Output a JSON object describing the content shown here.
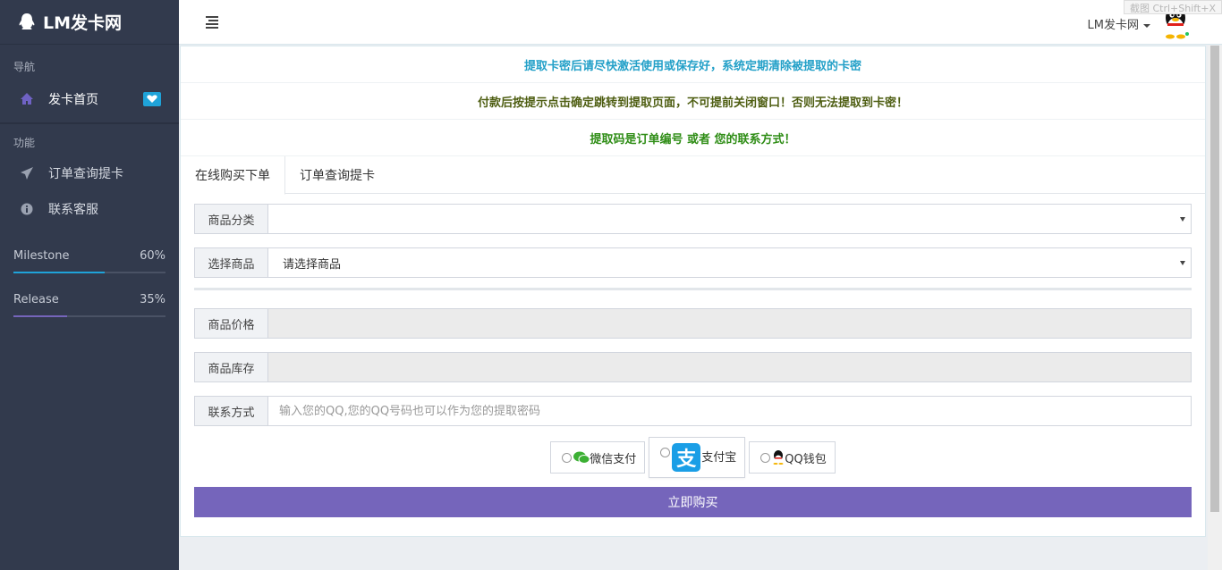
{
  "sidebar": {
    "brand": "LM发卡网",
    "sections": [
      {
        "title": "导航",
        "items": [
          {
            "label": "发卡首页",
            "icon": "home-icon",
            "active": true,
            "badge": "heart-icon"
          }
        ]
      },
      {
        "title": "功能",
        "items": [
          {
            "label": "订单查询提卡",
            "icon": "send-icon"
          },
          {
            "label": "联系客服",
            "icon": "info-icon"
          }
        ]
      }
    ],
    "progress": [
      {
        "label": "Milestone",
        "value": "60%",
        "fraction": 0.6,
        "color": "#1fa3d9"
      },
      {
        "label": "Release",
        "value": "35%",
        "fraction": 0.35,
        "color": "#7565bb"
      }
    ]
  },
  "header": {
    "user": "LM发卡网",
    "screenshot_hint": "截图 Ctrl+Shift+X"
  },
  "notices": [
    "提取卡密后请尽快激活使用或保存好，系统定期清除被提取的卡密",
    "付款后按提示点击确定跳转到提取页面，不可提前关闭窗口！否则无法提取到卡密！",
    "提取码是订单编号 或者 您的联系方式！"
  ],
  "tabs": [
    {
      "label": "在线购买下单",
      "active": true
    },
    {
      "label": "订单查询提卡",
      "active": false
    }
  ],
  "form": {
    "category_label": "商品分类",
    "category_value": "",
    "product_label": "选择商品",
    "product_value": "请选择商品",
    "price_label": "商品价格",
    "price_value": "",
    "stock_label": "商品库存",
    "stock_value": "",
    "contact_label": "联系方式",
    "contact_placeholder": "输入您的QQ,您的QQ号码也可以作为您的提取密码"
  },
  "payment": {
    "options": [
      {
        "label": "微信支付",
        "icon": "wechat-icon"
      },
      {
        "label": "支付宝",
        "icon": "alipay-icon"
      },
      {
        "label": "QQ钱包",
        "icon": "qq-penguin-icon"
      }
    ],
    "alipay_glyph": "支"
  },
  "buy_button": "立即购买",
  "colors": {
    "sidebar_bg": "#323a4d",
    "accent_purple": "#7565bb",
    "accent_blue": "#1fa3d9",
    "notice_blue": "#23a0c8",
    "notice_olive": "#4e5e12",
    "notice_green": "#2f8d16"
  }
}
